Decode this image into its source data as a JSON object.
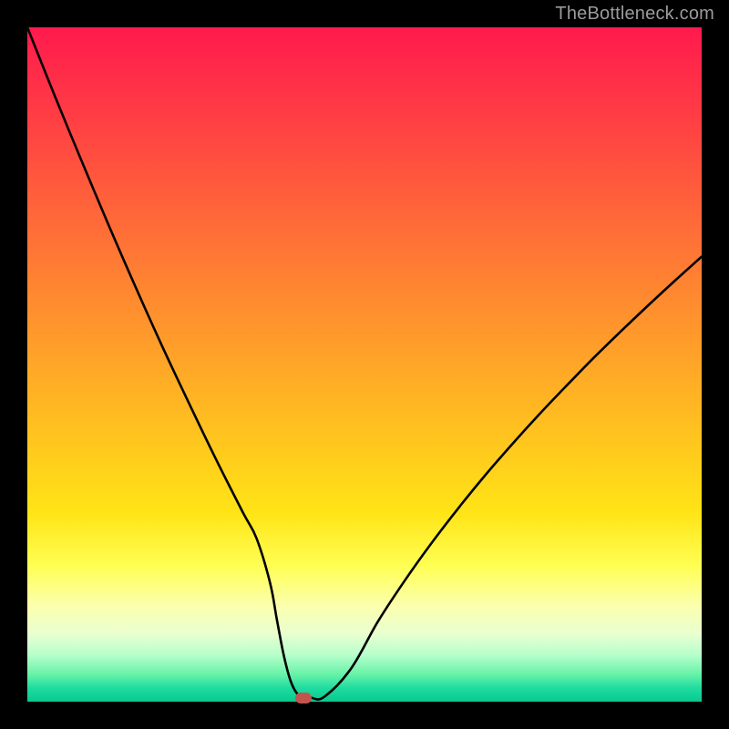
{
  "attribution": "TheBottleneck.com",
  "colors": {
    "page_bg": "#000000",
    "gradient_top": "#ff1a4d",
    "gradient_bottom": "#08c98f",
    "curve": "#000000",
    "marker": "#c1554d",
    "attribution_text": "#9b9b9b"
  },
  "chart_data": {
    "type": "line",
    "title": "",
    "xlabel": "",
    "ylabel": "",
    "xlim": [
      0,
      100
    ],
    "ylim": [
      0,
      100
    ],
    "grid": false,
    "x": [
      0,
      4,
      8,
      12,
      16,
      20,
      24,
      28,
      32,
      34,
      36,
      37,
      38,
      39,
      40,
      41,
      42,
      44,
      48,
      52,
      56,
      60,
      64,
      68,
      72,
      76,
      80,
      84,
      88,
      92,
      96,
      100
    ],
    "values": [
      100,
      90,
      80.3,
      70.8,
      61.6,
      52.7,
      44.2,
      35.9,
      28.0,
      24.2,
      17.6,
      12.2,
      7.0,
      3.2,
      1.2,
      0.7,
      0.6,
      0.7,
      4.9,
      11.9,
      18.0,
      23.6,
      28.8,
      33.7,
      38.3,
      42.7,
      46.9,
      51.0,
      54.9,
      58.7,
      62.4,
      66.0
    ],
    "marker": {
      "x": 41,
      "y": 0.6
    },
    "flat_bottom_range": {
      "x_start": 39,
      "x_end": 43,
      "y": 0.7
    }
  }
}
